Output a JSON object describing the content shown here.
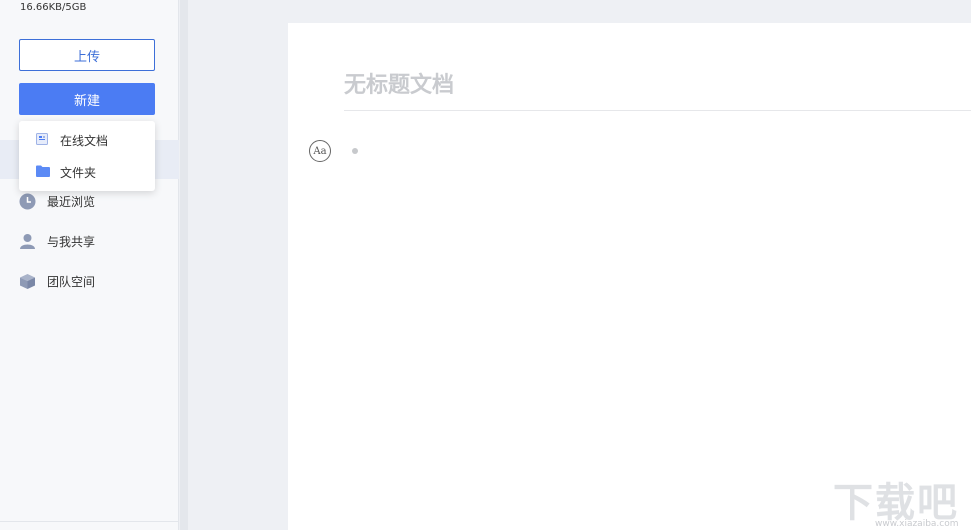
{
  "sidebar": {
    "storage": "16.66KB/5GB",
    "upload_label": "上传",
    "new_label": "新建",
    "items": [
      {
        "label": "最近浏览",
        "icon": "clock-icon"
      },
      {
        "label": "与我共享",
        "icon": "person-icon"
      },
      {
        "label": "团队空间",
        "icon": "cube-icon"
      }
    ]
  },
  "new_menu": {
    "items": [
      {
        "label": "在线文档",
        "icon": "online-doc-icon"
      },
      {
        "label": "文件夹",
        "icon": "folder-icon"
      }
    ]
  },
  "document": {
    "title_placeholder": "无标题文档",
    "format_button": "Aa"
  },
  "watermark": {
    "main": "下载吧",
    "sub": "www.xiazaiba.com"
  },
  "colors": {
    "accent": "#4b7cf3",
    "accent_border": "#3d6fd8",
    "icon_gray": "#8e9ab5"
  }
}
